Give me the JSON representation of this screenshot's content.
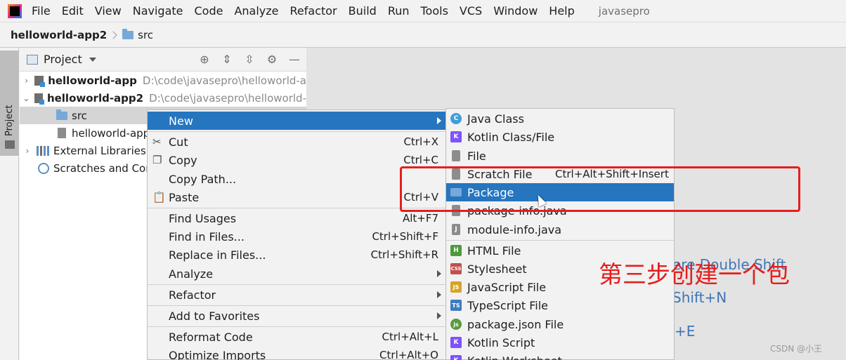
{
  "menubar": {
    "items": [
      "File",
      "Edit",
      "View",
      "Navigate",
      "Code",
      "Analyze",
      "Refactor",
      "Build",
      "Run",
      "Tools",
      "VCS",
      "Window",
      "Help"
    ],
    "project_name": "javasepro"
  },
  "breadcrumb": {
    "project": "helloworld-app2",
    "folder": "src"
  },
  "stripe": {
    "label": "Project"
  },
  "project_panel": {
    "title": "Project",
    "tree": [
      {
        "name": "helloworld-app",
        "path": "D:\\code\\javasepro\\helloworld-a"
      },
      {
        "name": "helloworld-app2",
        "path": "D:\\code\\javasepro\\helloworld-"
      },
      {
        "name": "src"
      },
      {
        "name": "helloworld-app"
      },
      {
        "name": "External Libraries"
      },
      {
        "name": "Scratches and Cor"
      }
    ]
  },
  "editor_hints": [
    "ere Double Shift",
    "Shift+N",
    "+E"
  ],
  "context_menu": [
    {
      "label": "New",
      "shortcut": ""
    },
    {
      "label": "Cut",
      "shortcut": "Ctrl+X"
    },
    {
      "label": "Copy",
      "shortcut": "Ctrl+C"
    },
    {
      "label": "Copy Path...",
      "shortcut": ""
    },
    {
      "label": "Paste",
      "shortcut": "Ctrl+V"
    },
    {
      "label": "Find Usages",
      "shortcut": "Alt+F7"
    },
    {
      "label": "Find in Files...",
      "shortcut": "Ctrl+Shift+F"
    },
    {
      "label": "Replace in Files...",
      "shortcut": "Ctrl+Shift+R"
    },
    {
      "label": "Analyze",
      "shortcut": ""
    },
    {
      "label": "Refactor",
      "shortcut": ""
    },
    {
      "label": "Add to Favorites",
      "shortcut": ""
    },
    {
      "label": "Reformat Code",
      "shortcut": "Ctrl+Alt+L"
    },
    {
      "label": "Optimize Imports",
      "shortcut": "Ctrl+Alt+O"
    }
  ],
  "submenu": [
    {
      "label": "Java Class",
      "shortcut": "",
      "icon": "C",
      "color": "#3f9ed8"
    },
    {
      "label": "Kotlin Class/File",
      "shortcut": "",
      "icon": "K",
      "color": "#7f52ff"
    },
    {
      "label": "File",
      "shortcut": "",
      "icon": "",
      "color": "#8c8c8c"
    },
    {
      "label": "Scratch File",
      "shortcut": "Ctrl+Alt+Shift+Insert",
      "icon": "",
      "color": "#8c8c8c"
    },
    {
      "label": "Package",
      "shortcut": "",
      "icon": "",
      "color": "#76a9d6"
    },
    {
      "label": "package-info.java",
      "shortcut": "",
      "icon": "",
      "color": "#8c8c8c"
    },
    {
      "label": "module-info.java",
      "shortcut": "",
      "icon": "J",
      "color": "#8c8c8c"
    },
    {
      "label": "HTML File",
      "shortcut": "",
      "icon": "H",
      "color": "#4e9a3d"
    },
    {
      "label": "Stylesheet",
      "shortcut": "",
      "icon": "CSS",
      "color": "#c0504d"
    },
    {
      "label": "JavaScript File",
      "shortcut": "",
      "icon": "JS",
      "color": "#d6a42a"
    },
    {
      "label": "TypeScript File",
      "shortcut": "",
      "icon": "TS",
      "color": "#3f7cc0"
    },
    {
      "label": "package.json File",
      "shortcut": "",
      "icon": "js",
      "color": "#5a9a3d"
    },
    {
      "label": "Kotlin Script",
      "shortcut": "",
      "icon": "K",
      "color": "#7f52ff"
    },
    {
      "label": "Kotlin Worksheet",
      "shortcut": "",
      "icon": "K",
      "color": "#7f52ff"
    }
  ],
  "annotation": {
    "text": "第三步创建一个包",
    "color": "#e51e1e"
  },
  "watermark": "CSDN @小王"
}
